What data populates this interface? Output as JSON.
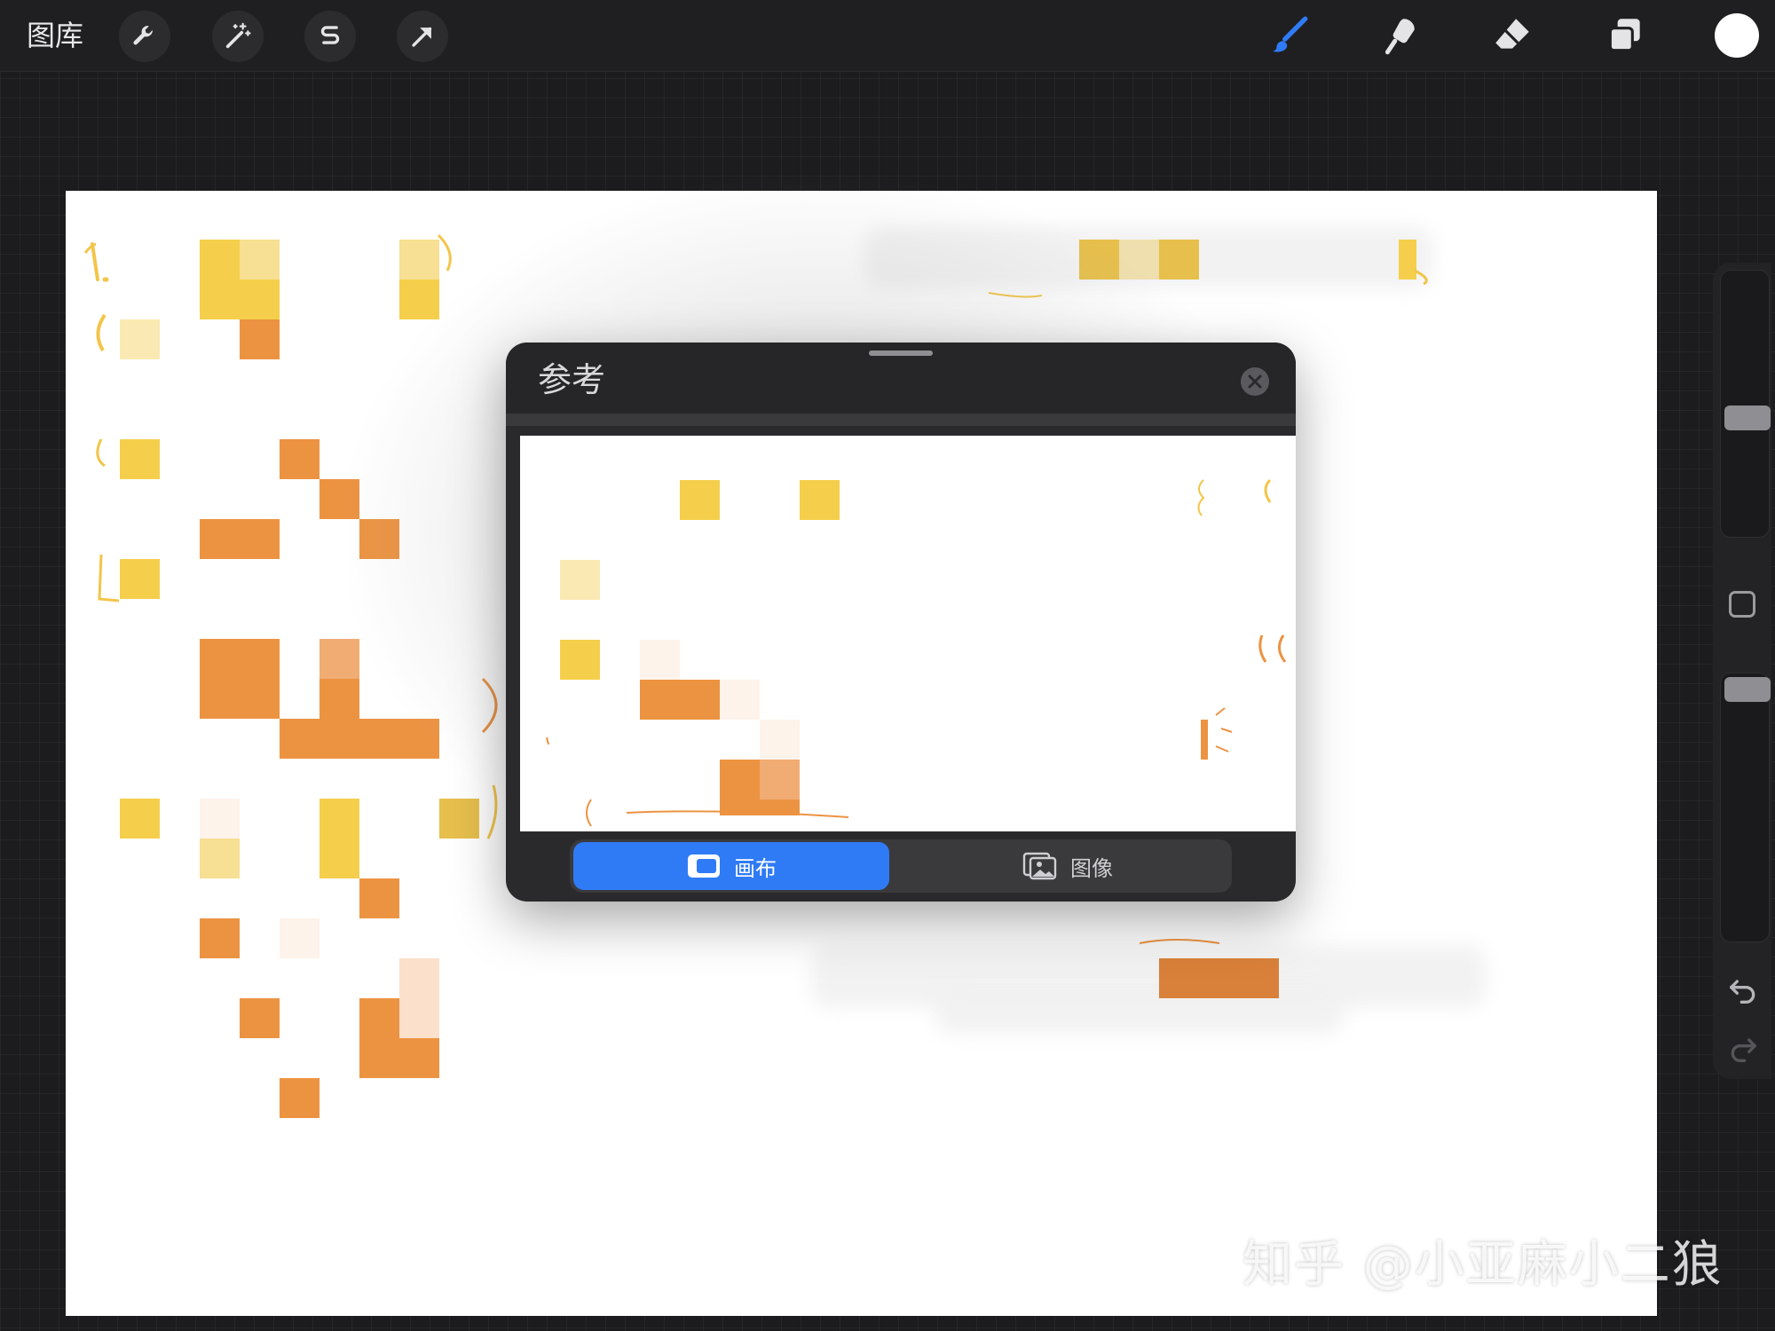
{
  "topbar": {
    "gallery_label": "图库",
    "left_tools": [
      {
        "name": "wrench-icon"
      },
      {
        "name": "magic-wand-icon"
      },
      {
        "name": "selection-s-icon"
      },
      {
        "name": "arrow-cursor-icon"
      }
    ],
    "right_tools": [
      {
        "name": "brush-icon",
        "color": "#2f7bf6"
      },
      {
        "name": "smudge-icon"
      },
      {
        "name": "eraser-icon"
      },
      {
        "name": "layers-icon"
      }
    ],
    "current_color": "#ffffff"
  },
  "reference_panel": {
    "title": "参考",
    "close_icon": "close-icon",
    "segments": [
      {
        "label": "画布",
        "icon": "canvas-icon",
        "active": true
      },
      {
        "label": "图像",
        "icon": "image-icon",
        "active": false
      }
    ],
    "accent": "#2f7bf6"
  },
  "sidebar": {
    "brush_size_level": 0.55,
    "opacity_level": 0.05,
    "icons": [
      "modify-square-icon",
      "undo-icon",
      "redo-icon"
    ]
  },
  "watermark": "知乎 @小亚麻小二狼"
}
